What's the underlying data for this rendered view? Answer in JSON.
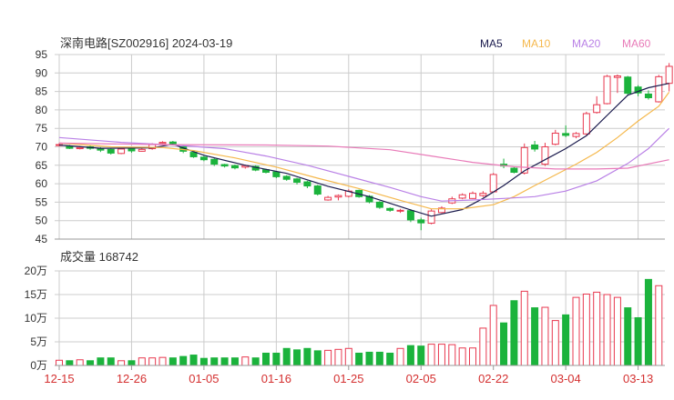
{
  "title": "深南电路[SZ002916] 2024-03-19",
  "legend": [
    {
      "name": "MA5",
      "color": "#1a1a4d"
    },
    {
      "name": "MA10",
      "color": "#f5b84c"
    },
    {
      "name": "MA20",
      "color": "#b980e6"
    },
    {
      "name": "MA60",
      "color": "#e87ab8"
    }
  ],
  "volume_label": "成交量 168742",
  "colors": {
    "up": "#e8384f",
    "down": "#1bb33c",
    "grid": "#cccccc",
    "axis": "#333333",
    "xlabel": "#d43030"
  },
  "chart_data": [
    {
      "type": "candlestick",
      "ylim": [
        45,
        95
      ],
      "yticks": [
        45,
        50,
        55,
        60,
        65,
        70,
        75,
        80,
        85,
        90,
        95
      ],
      "xticks": [
        {
          "i": 0,
          "label": "12-15"
        },
        {
          "i": 7,
          "label": "12-26"
        },
        {
          "i": 14,
          "label": "01-05"
        },
        {
          "i": 21,
          "label": "01-16"
        },
        {
          "i": 28,
          "label": "01-25"
        },
        {
          "i": 35,
          "label": "02-05"
        },
        {
          "i": 42,
          "label": "02-22"
        },
        {
          "i": 49,
          "label": "03-04"
        },
        {
          "i": 56,
          "label": "03-13"
        }
      ],
      "candles": [
        [
          70.4,
          70.6,
          71.0,
          70.1
        ],
        [
          70.1,
          69.6,
          70.5,
          69.4
        ],
        [
          69.5,
          69.8,
          70.2,
          69.3
        ],
        [
          70.0,
          69.6,
          70.3,
          69.2
        ],
        [
          69.5,
          69.1,
          69.9,
          68.6
        ],
        [
          69.3,
          68.3,
          69.5,
          67.9
        ],
        [
          68.2,
          69.4,
          69.7,
          68.0
        ],
        [
          69.5,
          68.9,
          69.8,
          68.4
        ],
        [
          68.8,
          69.3,
          69.6,
          68.7
        ],
        [
          69.5,
          70.6,
          71.0,
          69.2
        ],
        [
          70.9,
          71.2,
          71.5,
          70.7
        ],
        [
          71.3,
          70.7,
          71.6,
          70.4
        ],
        [
          70.0,
          68.8,
          70.4,
          68.3
        ],
        [
          68.5,
          67.3,
          68.8,
          67.0
        ],
        [
          67.2,
          66.5,
          67.5,
          66.1
        ],
        [
          66.6,
          65.3,
          66.9,
          64.8
        ],
        [
          65.2,
          64.8,
          65.4,
          64.4
        ],
        [
          64.9,
          64.3,
          65.2,
          63.9
        ],
        [
          64.5,
          64.9,
          65.2,
          64.1
        ],
        [
          64.7,
          63.7,
          65.0,
          63.4
        ],
        [
          63.8,
          63.1,
          64.1,
          62.8
        ],
        [
          63.2,
          61.9,
          63.4,
          61.5
        ],
        [
          62.0,
          61.2,
          62.3,
          60.8
        ],
        [
          61.3,
          60.4,
          61.6,
          59.8
        ],
        [
          60.5,
          59.4,
          60.8,
          58.8
        ],
        [
          59.4,
          57.2,
          59.7,
          56.8
        ],
        [
          55.6,
          56.3,
          56.7,
          55.4
        ],
        [
          56.4,
          56.8,
          57.1,
          55.5
        ],
        [
          56.6,
          58.0,
          58.5,
          56.3
        ],
        [
          58.2,
          56.5,
          58.4,
          56.2
        ],
        [
          56.6,
          55.1,
          56.9,
          54.7
        ],
        [
          55.0,
          53.6,
          55.3,
          53.2
        ],
        [
          53.3,
          52.8,
          53.6,
          52.4
        ],
        [
          52.6,
          52.8,
          53.2,
          52.1
        ],
        [
          52.7,
          50.2,
          53.1,
          49.6
        ],
        [
          50.2,
          49.4,
          50.8,
          47.4
        ],
        [
          49.3,
          52.6,
          53.1,
          49.0
        ],
        [
          52.2,
          53.4,
          53.9,
          52.0
        ],
        [
          54.8,
          55.9,
          56.5,
          54.5
        ],
        [
          56.1,
          57.0,
          57.4,
          55.8
        ],
        [
          56.0,
          57.4,
          57.9,
          55.9
        ],
        [
          56.8,
          57.4,
          58.0,
          56.4
        ],
        [
          57.8,
          62.5,
          62.9,
          57.7
        ],
        [
          65.3,
          64.8,
          66.8,
          64.2
        ],
        [
          64.2,
          63.1,
          64.5,
          62.8
        ],
        [
          62.9,
          69.8,
          70.9,
          62.5
        ],
        [
          70.5,
          69.4,
          71.6,
          68.7
        ],
        [
          65.3,
          70.0,
          71.1,
          64.8
        ],
        [
          70.7,
          73.7,
          74.6,
          70.4
        ],
        [
          73.6,
          73.1,
          75.8,
          72.6
        ],
        [
          72.8,
          73.6,
          74.0,
          72.3
        ],
        [
          73.5,
          79.0,
          79.5,
          73.2
        ],
        [
          79.3,
          81.4,
          83.7,
          79.0
        ],
        [
          81.7,
          89.1,
          89.5,
          81.5
        ],
        [
          88.8,
          89.2,
          89.6,
          84.6
        ],
        [
          88.9,
          84.5,
          89.2,
          83.8
        ],
        [
          86.2,
          84.6,
          86.7,
          83.7
        ],
        [
          84.3,
          83.3,
          85.3,
          82.8
        ],
        [
          82.2,
          89.0,
          89.5,
          82.0
        ],
        [
          87.2,
          91.8,
          92.7,
          85.0
        ]
      ],
      "ma": {
        "MA5": [
          [
            0,
            70.5
          ],
          [
            4,
            69.6
          ],
          [
            9,
            69.7
          ],
          [
            11,
            70.7
          ],
          [
            14,
            67.7
          ],
          [
            18,
            65.0
          ],
          [
            22,
            62.8
          ],
          [
            26,
            59.3
          ],
          [
            30,
            56.5
          ],
          [
            34,
            52.9
          ],
          [
            36,
            51.2
          ],
          [
            39,
            53.0
          ],
          [
            41,
            56.0
          ],
          [
            43,
            59.5
          ],
          [
            45,
            63.5
          ],
          [
            47,
            66.5
          ],
          [
            49,
            69.5
          ],
          [
            51,
            73.0
          ],
          [
            53,
            78.5
          ],
          [
            55,
            84.0
          ],
          [
            57,
            86.0
          ],
          [
            59,
            87.2
          ]
        ],
        "MA10": [
          [
            0,
            71.0
          ],
          [
            5,
            70.0
          ],
          [
            10,
            69.8
          ],
          [
            13,
            69.0
          ],
          [
            17,
            67.0
          ],
          [
            21,
            64.5
          ],
          [
            25,
            61.5
          ],
          [
            29,
            58.7
          ],
          [
            33,
            55.5
          ],
          [
            36,
            53.2
          ],
          [
            39,
            53.2
          ],
          [
            42,
            54.3
          ],
          [
            44,
            56.5
          ],
          [
            46,
            59.5
          ],
          [
            48,
            62.4
          ],
          [
            50,
            65.3
          ],
          [
            52,
            68.5
          ],
          [
            54,
            72.5
          ],
          [
            56,
            77.0
          ],
          [
            58,
            81.0
          ],
          [
            59,
            84.8
          ]
        ],
        "MA20": [
          [
            0,
            72.5
          ],
          [
            6,
            71.2
          ],
          [
            11,
            70.5
          ],
          [
            16,
            69.5
          ],
          [
            20,
            67.5
          ],
          [
            24,
            65.0
          ],
          [
            28,
            62.0
          ],
          [
            32,
            59.0
          ],
          [
            35,
            56.5
          ],
          [
            37,
            55.3
          ],
          [
            40,
            55.6
          ],
          [
            43,
            56.0
          ],
          [
            46,
            56.5
          ],
          [
            49,
            58.0
          ],
          [
            52,
            60.8
          ],
          [
            55,
            65.5
          ],
          [
            57,
            69.5
          ],
          [
            59,
            75.0
          ]
        ],
        "MA60": [
          [
            0,
            71.0
          ],
          [
            10,
            70.6
          ],
          [
            20,
            70.5
          ],
          [
            26,
            70.2
          ],
          [
            32,
            69.2
          ],
          [
            36,
            67.5
          ],
          [
            40,
            65.8
          ],
          [
            44,
            64.6
          ],
          [
            48,
            64.0
          ],
          [
            52,
            64.0
          ],
          [
            55,
            64.2
          ],
          [
            59,
            66.5
          ]
        ]
      }
    },
    {
      "type": "bar",
      "ylim": [
        0,
        200000
      ],
      "yticks": [
        {
          "v": 0,
          "label": "0万"
        },
        {
          "v": 50000,
          "label": "5万"
        },
        {
          "v": 100000,
          "label": "10万"
        },
        {
          "v": 150000,
          "label": "15万"
        },
        {
          "v": 200000,
          "label": "20万"
        }
      ],
      "volumes": [
        11000,
        10000,
        12000,
        10000,
        16000,
        16000,
        10000,
        10000,
        16000,
        16000,
        17000,
        16000,
        19000,
        22000,
        15000,
        16000,
        16000,
        16000,
        18000,
        16000,
        26000,
        26000,
        36000,
        33000,
        36000,
        31000,
        32000,
        34000,
        36000,
        26000,
        28000,
        28000,
        26000,
        36000,
        42000,
        41000,
        45000,
        45000,
        44000,
        37000,
        37000,
        79000,
        127000,
        90000,
        137000,
        157000,
        122000,
        123000,
        95000,
        107000,
        144000,
        151000,
        155000,
        150000,
        144000,
        122000,
        101000,
        182000,
        168742
      ]
    }
  ]
}
